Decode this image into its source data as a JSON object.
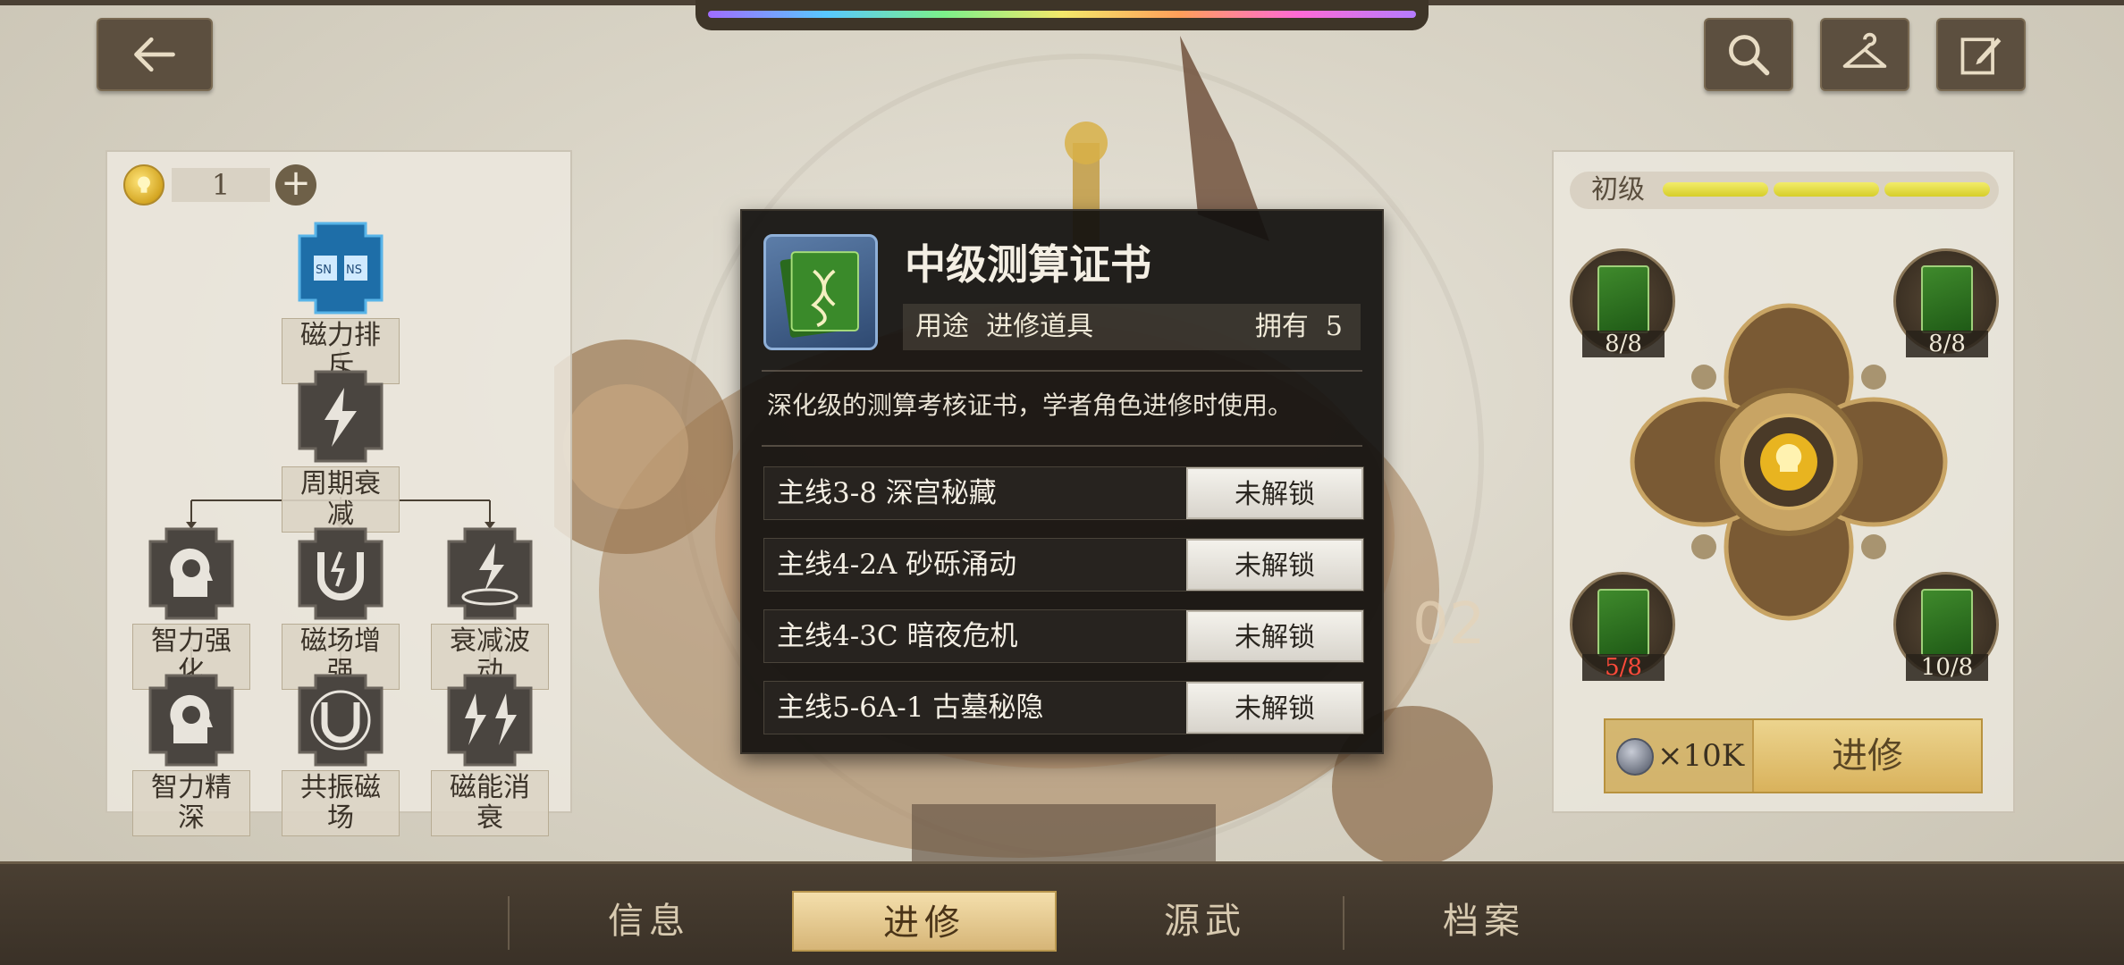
{
  "top_buttons": {
    "back_icon": "back-arrow-icon",
    "search_icon": "search-icon",
    "wardrobe_icon": "hanger-icon",
    "edit_icon": "edit-icon"
  },
  "skill_panel": {
    "points": "1",
    "plus": "+",
    "nodes": [
      {
        "label": "磁力排斥",
        "icon": "magnet-repel-icon"
      },
      {
        "label": "周期衰减",
        "icon": "lightning-icon"
      },
      {
        "label": "智力强化",
        "icon": "brain-head-icon"
      },
      {
        "label": "磁场增强",
        "icon": "magnet-field-icon"
      },
      {
        "label": "衰减波动",
        "icon": "lightning-wave-icon"
      },
      {
        "label": "智力精深",
        "icon": "brain-head-icon"
      },
      {
        "label": "共振磁场",
        "icon": "magnet-field-icon"
      },
      {
        "label": "磁能消衰",
        "icon": "lightning-burst-icon"
      }
    ]
  },
  "tooltip": {
    "title": "中级测算证书",
    "use_label": "用途",
    "use_value": "进修道具",
    "own_label": "拥有",
    "own_value": "5",
    "description": "深化级的测算考核证书，学者角色进修时使用。",
    "stages": [
      {
        "name": "主线3-8 深宫秘藏",
        "status": "未解锁"
      },
      {
        "name": "主线4-2A 砂砾涌动",
        "status": "未解锁"
      },
      {
        "name": "主线4-3C 暗夜危机",
        "status": "未解锁"
      },
      {
        "name": "主线5-6A-1 古墓秘隐",
        "status": "未解锁"
      }
    ]
  },
  "upgrade_panel": {
    "level_label": "初级",
    "level_segments_filled": 3,
    "materials": [
      {
        "qty": "8/8",
        "enough": true
      },
      {
        "qty": "8/8",
        "enough": true
      },
      {
        "qty": "5/8",
        "enough": false
      },
      {
        "qty": "10/8",
        "enough": true
      }
    ],
    "cost": "×10K",
    "button_label": "进修"
  },
  "bottom_nav": {
    "tabs": [
      {
        "label": "信息",
        "active": false
      },
      {
        "label": "进修",
        "active": true
      },
      {
        "label": "源武",
        "active": false
      },
      {
        "label": "档案",
        "active": false
      }
    ]
  },
  "colors": {
    "accent_gold": "#d9b25c",
    "insufficient_red": "#ff4a3a",
    "level_bar_yellow": "#e6de3a"
  }
}
